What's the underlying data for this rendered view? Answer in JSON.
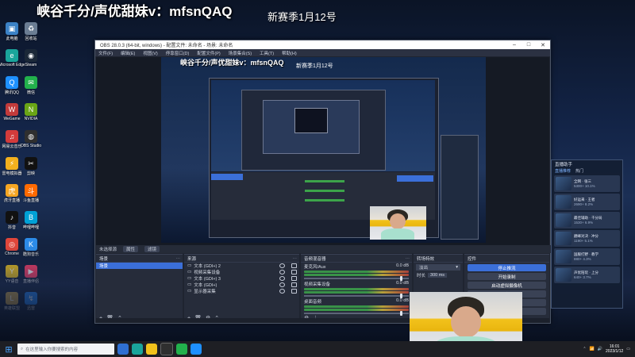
{
  "overlay": {
    "title": "峡谷千分/声优甜妹v：mfsnQAQ",
    "subtitle": "新赛季1月12号"
  },
  "obs": {
    "window_title": "OBS 28.0.3 (64-bit, windows) - 配置文件: 未命名 - 场景: 未命名",
    "menu": [
      "文件(F)",
      "编辑(E)",
      "视图(V)",
      "停靠窗口(D)",
      "配置文件(P)",
      "场景集合(S)",
      "工具(T)",
      "帮助(H)"
    ],
    "tabbar": {
      "no_source": "未选择源",
      "properties": "属性",
      "filters": "滤镜"
    },
    "scenes": {
      "header": "场景",
      "items": [
        "场景"
      ]
    },
    "sources": {
      "header": "来源",
      "items": [
        "文本 (GDI+) 2",
        "视频采集设备",
        "文本 (GDI+) 3",
        "文本 (GDI+)",
        "显示器采集"
      ]
    },
    "mixer": {
      "header": "音频混音器",
      "channels": [
        {
          "name": "麦克风/Aux",
          "db": "0.0 dB"
        },
        {
          "name": "视频采集设备",
          "db": "0.0 dB"
        },
        {
          "name": "桌面音频",
          "db": "0.0 dB"
        }
      ]
    },
    "transitions": {
      "header": "转场特效",
      "type": "淡出",
      "duration_label": "时长",
      "duration_value": "300 ms"
    },
    "controls": {
      "header": "控件",
      "buttons": [
        "停止推流",
        "开始录制",
        "启动虚拟摄像机",
        "工作室模式",
        "设置",
        "退出"
      ]
    }
  },
  "widget": {
    "title": "直播助手",
    "tabs": [
      "直播推荐",
      "热门"
    ],
    "items": [
      {
        "title": "全网 · 张三",
        "meta": "5300+ 10.1%"
      },
      {
        "title": "好运来 · 王者",
        "meta": "2690+ 8.2%"
      },
      {
        "title": "最佳辅助 · 千分局",
        "meta": "1530+ 6.9%"
      },
      {
        "title": "巅峰对决 · 冲分",
        "meta": "1190+ 5.1%"
      },
      {
        "title": "国服打野 · 教学",
        "meta": "880+ 4.3%"
      },
      {
        "title": "声优陪玩 · 上分",
        "meta": "640+ 3.7%"
      }
    ]
  },
  "taskbar": {
    "search_placeholder": "在这里输入你要搜索的内容",
    "time": "16:01",
    "date": "2023/1/12"
  },
  "desktop_icons": [
    {
      "label": "此电脑",
      "color": "#3b82c6",
      "glyph": "▣"
    },
    {
      "label": "回收站",
      "color": "#6b7d93",
      "glyph": "♻"
    },
    {
      "label": "Microsoft Edge",
      "color": "#1aa59b",
      "glyph": "e"
    },
    {
      "label": "Steam",
      "color": "#1b2838",
      "glyph": "◉"
    },
    {
      "label": "腾讯QQ",
      "color": "#1e90ff",
      "glyph": "Q"
    },
    {
      "label": "微信",
      "color": "#22b14c",
      "glyph": "✉"
    },
    {
      "label": "WeGame",
      "color": "#c23b3b",
      "glyph": "W"
    },
    {
      "label": "NVIDIA",
      "color": "#6aa516",
      "glyph": "N"
    },
    {
      "label": "网易云音乐",
      "color": "#d33b3b",
      "glyph": "♫"
    },
    {
      "label": "OBS Studio",
      "color": "#2f2f2f",
      "glyph": "◍"
    },
    {
      "label": "雷电模拟器",
      "color": "#f2b01e",
      "glyph": "⚡"
    },
    {
      "label": "剪映",
      "color": "#111111",
      "glyph": "✂"
    },
    {
      "label": "虎牙直播",
      "color": "#f5a623",
      "glyph": "虎"
    },
    {
      "label": "斗鱼直播",
      "color": "#ff6a00",
      "glyph": "斗"
    },
    {
      "label": "抖音",
      "color": "#111111",
      "glyph": "♪"
    },
    {
      "label": "哔哩哔哩",
      "color": "#00a1d6",
      "glyph": "B"
    },
    {
      "label": "Chrome",
      "color": "#e0463a",
      "glyph": "◎"
    },
    {
      "label": "酷狗音乐",
      "color": "#2c8be8",
      "glyph": "K"
    },
    {
      "label": "YY语音",
      "color": "#f0c419",
      "glyph": "Y"
    },
    {
      "label": "直播伴侣",
      "color": "#ff3c64",
      "glyph": "▶"
    },
    {
      "label": "英雄联盟",
      "color": "#c9a043",
      "glyph": "L"
    },
    {
      "label": "迅雷",
      "color": "#1d7ff0",
      "glyph": "↯"
    }
  ]
}
